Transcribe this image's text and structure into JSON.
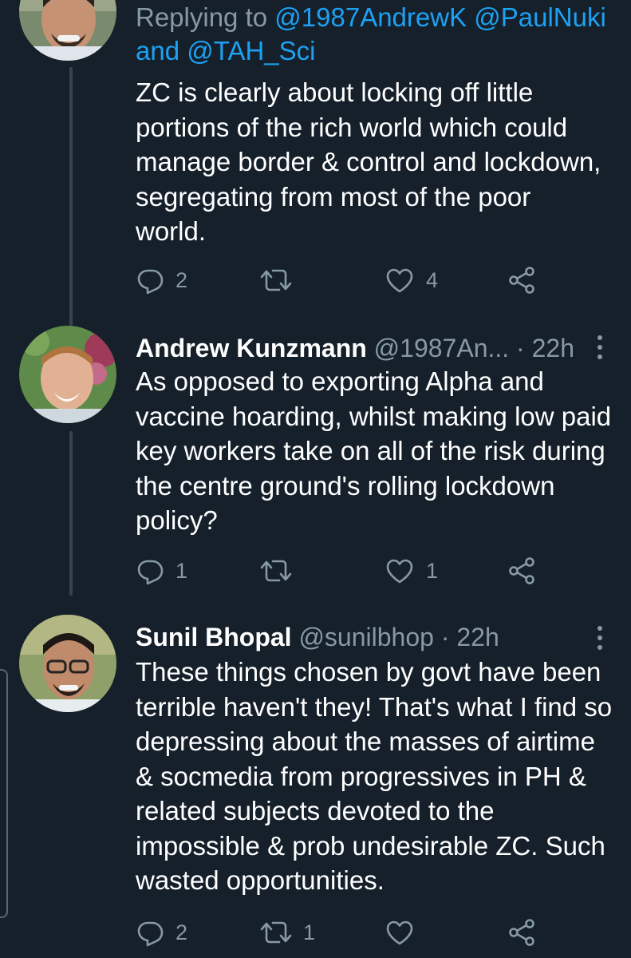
{
  "tweets": [
    {
      "replying_prefix": "Replying to",
      "replying_mentions_line1": "@1987AndrewK @PaulNuki",
      "replying_and": "and",
      "replying_mention_line2": "@TAH_Sci",
      "text_lines": [
        "ZC is clearly about locking off little",
        "portions of the rich world which could",
        "manage border & control and lockdown,",
        "segregating from most of the poor",
        "world."
      ],
      "replies": "2",
      "retweets": "",
      "likes": "4"
    },
    {
      "name": "Andrew Kunzmann",
      "handle": "@1987An...",
      "separator": "·",
      "time": "22h",
      "text_lines": [
        "As opposed to exporting Alpha and",
        "vaccine hoarding, whilst making low paid",
        "key workers take on all of the risk during",
        "the centre ground's rolling lockdown",
        "policy?"
      ],
      "replies": "1",
      "retweets": "",
      "likes": "1"
    },
    {
      "name": "Sunil Bhopal",
      "handle": "@sunilbhop",
      "separator": "·",
      "time": "22h",
      "text_lines": [
        "These things chosen by govt have been",
        "terrible haven't they! That's what I find so",
        "depressing about the masses of airtime",
        "& socmedia from progressives in PH &",
        "related subjects devoted to the",
        "impossible & prob undesirable ZC. Such",
        "wasted opportunities."
      ],
      "replies": "2",
      "retweets": "1",
      "likes": ""
    }
  ],
  "colors": {
    "background": "#15202b",
    "text": "#ffffff",
    "muted": "#8899a6",
    "link": "#1da1f2",
    "thread_line": "#38444d"
  },
  "icons": [
    "reply-icon",
    "retweet-icon",
    "like-icon",
    "share-icon",
    "more-options-icon",
    "avatar"
  ]
}
